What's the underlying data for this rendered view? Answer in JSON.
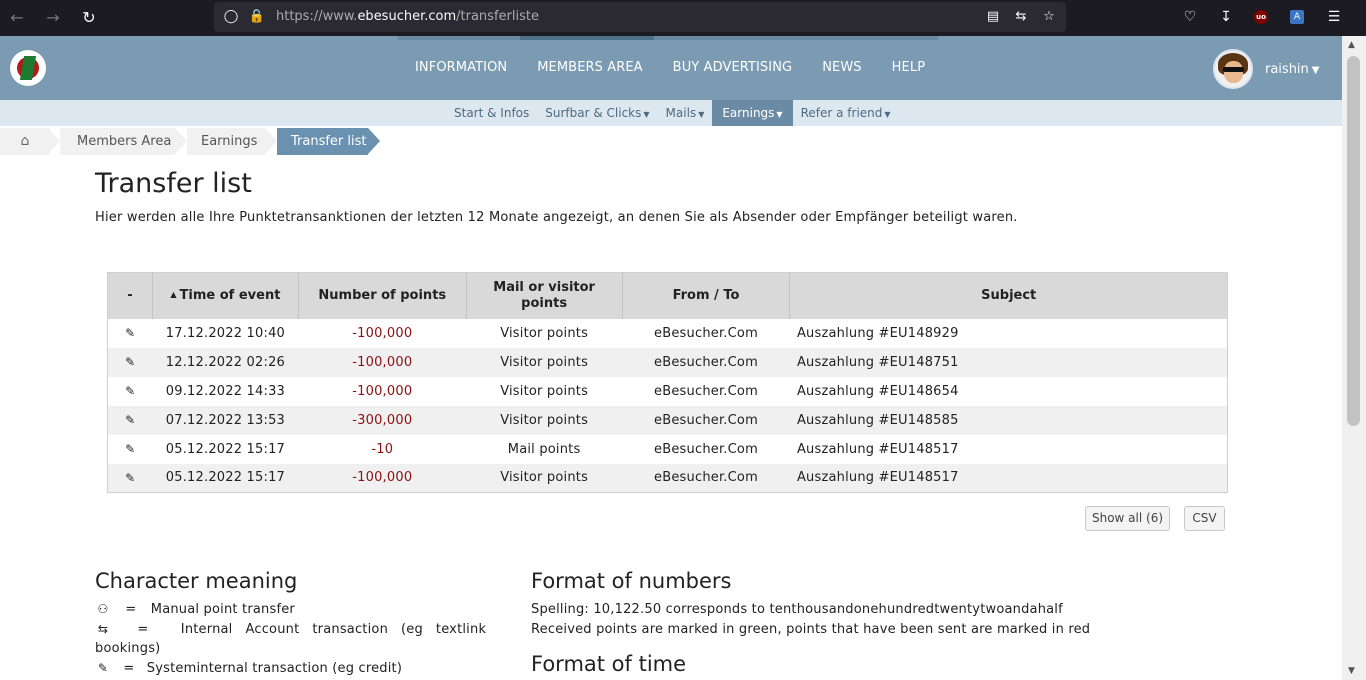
{
  "browser": {
    "url_prefix": "https://www.",
    "url_domain": "ebesucher.com",
    "url_path": "/transferliste",
    "ublock_label": "uo",
    "translate_label": "A"
  },
  "header": {
    "nav": [
      "INFORMATION",
      "MEMBERS AREA",
      "BUY ADVERTISING",
      "NEWS",
      "HELP"
    ],
    "username": "raishin"
  },
  "subnav": {
    "items": [
      {
        "label": "Start & Infos",
        "caret": false
      },
      {
        "label": "Surfbar & Clicks",
        "caret": true
      },
      {
        "label": "Mails",
        "caret": true
      },
      {
        "label": "Earnings",
        "caret": true,
        "active": true
      },
      {
        "label": "Refer a friend",
        "caret": true
      }
    ]
  },
  "breadcrumb": {
    "items": [
      "Members Area",
      "Earnings"
    ],
    "active": "Transfer list"
  },
  "page": {
    "title": "Transfer list",
    "description": "Hier werden alle Ihre Punktetransanktionen der letzten 12 Monate angezeigt, an denen Sie als Absender oder Empfänger beteiligt waren."
  },
  "table": {
    "headers": [
      "-",
      "Time of event",
      "Number of points",
      "Mail or visitor points",
      "From / To",
      "Subject"
    ],
    "rows": [
      [
        "17.12.2022 10:40",
        "-100,000",
        "Visitor points",
        "eBesucher.Com",
        "Auszahlung #EU148929"
      ],
      [
        "12.12.2022 02:26",
        "-100,000",
        "Visitor points",
        "eBesucher.Com",
        "Auszahlung #EU148751"
      ],
      [
        "09.12.2022 14:33",
        "-100,000",
        "Visitor points",
        "eBesucher.Com",
        "Auszahlung #EU148654"
      ],
      [
        "07.12.2022 13:53",
        "-300,000",
        "Visitor points",
        "eBesucher.Com",
        "Auszahlung #EU148585"
      ],
      [
        "05.12.2022 15:17",
        "-10",
        "Mail points",
        "eBesucher.Com",
        "Auszahlung #EU148517"
      ],
      [
        "05.12.2022 15:17",
        "-100,000",
        "Visitor points",
        "eBesucher.Com",
        "Auszahlung #EU148517"
      ]
    ],
    "negative_color": "#8b1010"
  },
  "buttons": {
    "show_all": "Show all (6)",
    "csv": "CSV"
  },
  "character_meaning": {
    "title": "Character meaning",
    "items": [
      {
        "symbol": "⚇",
        "sep": "=",
        "text": "Manual point transfer"
      },
      {
        "symbol": "⇆",
        "sep": "=",
        "text": "Internal   Account   transaction   (eg   textlink"
      },
      {
        "symbol": "",
        "sep": "",
        "text": "bookings)"
      },
      {
        "symbol": "✎",
        "sep": "=",
        "text": "Systeminternal transaction (eg credit)"
      }
    ]
  },
  "format_numbers": {
    "title": "Format of numbers",
    "line1": "Spelling: 10,122.50 corresponds to tenthousandonehundredtwentytwoandahalf",
    "line2": "Received points are marked in green, points that have been sent are marked in red"
  },
  "format_time": {
    "title": "Format of time"
  },
  "colors": {
    "header_bg": "#7b9bb3",
    "subnav_bg": "#dde7ef",
    "active_tab": "#6b8aa4"
  }
}
